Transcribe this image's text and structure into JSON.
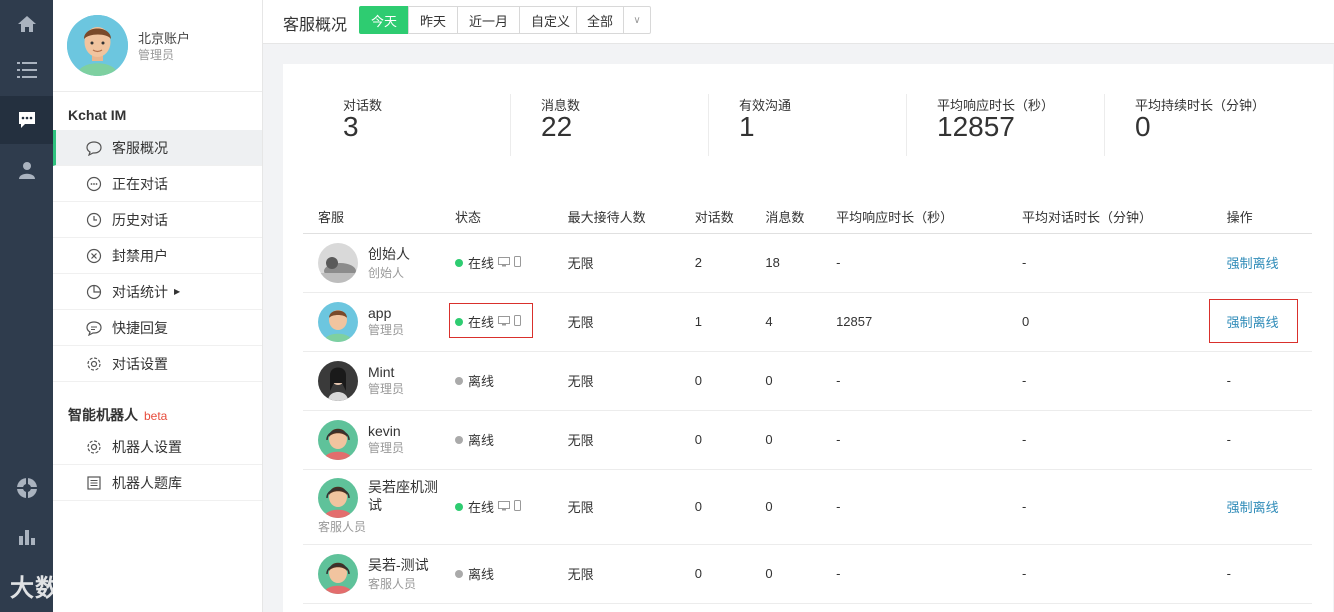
{
  "rail": {
    "icons": [
      "home-icon",
      "list-icon",
      "chat-icon",
      "user-icon",
      "robot-icon",
      "bar-chart-icon",
      "settings-icon"
    ]
  },
  "profile": {
    "name": "北京账户",
    "role": "管理员"
  },
  "sidebar": {
    "section1": "Kchat IM",
    "items1": [
      {
        "label": "客服概况",
        "icon": "speech-bubble-icon"
      },
      {
        "label": "正在对话",
        "icon": "chat-dots-icon"
      },
      {
        "label": "历史对话",
        "icon": "clock-icon"
      },
      {
        "label": "封禁用户",
        "icon": "ban-icon"
      },
      {
        "label": "对话统计",
        "icon": "pie-chart-icon"
      },
      {
        "label": "快捷回复",
        "icon": "quick-reply-icon"
      },
      {
        "label": "对话设置",
        "icon": "gear-icon"
      }
    ],
    "section2": "智能机器人",
    "section2_badge": "beta",
    "items2": [
      {
        "label": "机器人设置",
        "icon": "gear-icon"
      },
      {
        "label": "机器人题库",
        "icon": "list-doc-icon"
      }
    ]
  },
  "topbar": {
    "title": "客服概况",
    "ranges": [
      "今天",
      "昨天",
      "近一月",
      "自定义"
    ],
    "active_range": "今天",
    "filter_value": "全部"
  },
  "stats": [
    {
      "label": "对话数",
      "value": "3"
    },
    {
      "label": "消息数",
      "value": "22"
    },
    {
      "label": "有效沟通",
      "value": "1"
    },
    {
      "label": "平均响应时长（秒）",
      "value": "12857"
    },
    {
      "label": "平均持续时长（分钟）",
      "value": "0"
    }
  ],
  "table": {
    "headers": [
      "客服",
      "状态",
      "最大接待人数",
      "对话数",
      "消息数",
      "平均响应时长（秒）",
      "平均对话时长（分钟）",
      "操作"
    ],
    "rows": [
      {
        "name": "创始人",
        "role": "创始人",
        "status": "在线",
        "online": true,
        "max": "无限",
        "chats": "2",
        "msgs": "18",
        "resp": "-",
        "dur": "-",
        "op": "强制离线"
      },
      {
        "name": "app",
        "role": "管理员",
        "status": "在线",
        "online": true,
        "max": "无限",
        "chats": "1",
        "msgs": "4",
        "resp": "12857",
        "dur": "0",
        "op": "强制离线"
      },
      {
        "name": "Mint",
        "role": "管理员",
        "status": "离线",
        "online": false,
        "max": "无限",
        "chats": "0",
        "msgs": "0",
        "resp": "-",
        "dur": "-",
        "op": "-"
      },
      {
        "name": "kevin",
        "role": "管理员",
        "status": "离线",
        "online": false,
        "max": "无限",
        "chats": "0",
        "msgs": "0",
        "resp": "-",
        "dur": "-",
        "op": "-"
      },
      {
        "name": "吴若座机测试",
        "role": "客服人员",
        "status": "在线",
        "online": true,
        "max": "无限",
        "chats": "0",
        "msgs": "0",
        "resp": "-",
        "dur": "-",
        "op": "强制离线"
      },
      {
        "name": "吴若-测试",
        "role": "客服人员",
        "status": "离线",
        "online": false,
        "max": "无限",
        "chats": "0",
        "msgs": "0",
        "resp": "-",
        "dur": "-",
        "op": "-"
      }
    ]
  },
  "watermark": "大数跨境",
  "colors": {
    "accent": "#2ecc71",
    "link": "#2e8bb8",
    "rail": "#2f3c4d",
    "highlight": "#d9302c"
  }
}
